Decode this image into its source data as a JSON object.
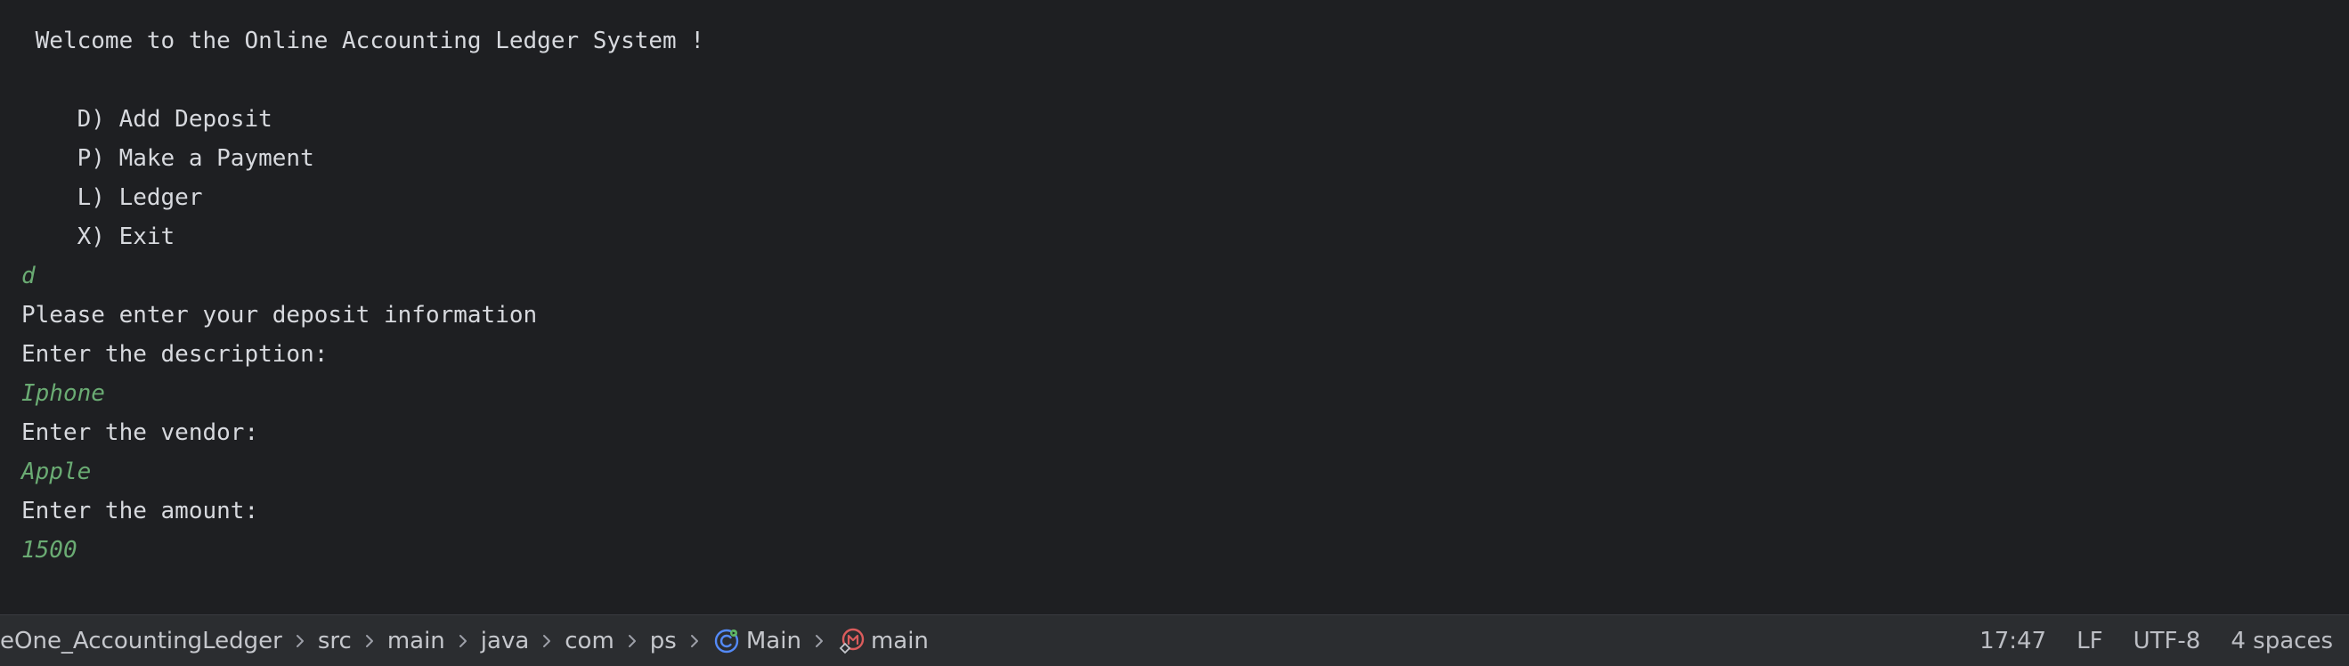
{
  "console": {
    "lines": [
      {
        "text": " Welcome to the Online Accounting Ledger System !",
        "kind": "output"
      },
      {
        "text": "    D) Add Deposit",
        "kind": "output"
      },
      {
        "text": "    P) Make a Payment",
        "kind": "output"
      },
      {
        "text": "    L) Ledger",
        "kind": "output"
      },
      {
        "text": "    X) Exit",
        "kind": "output"
      },
      {
        "text": "d",
        "kind": "input"
      },
      {
        "text": "Please enter your deposit information",
        "kind": "output"
      },
      {
        "text": "Enter the description:",
        "kind": "output"
      },
      {
        "text": "Iphone",
        "kind": "input"
      },
      {
        "text": "Enter the vendor:",
        "kind": "output"
      },
      {
        "text": "Apple",
        "kind": "input"
      },
      {
        "text": "Enter the amount:",
        "kind": "output"
      },
      {
        "text": "1500",
        "kind": "input"
      }
    ],
    "colors": {
      "background": "#1e1f22",
      "output_text": "#d7d9de",
      "user_input_text": "#6aab73"
    }
  },
  "status_bar": {
    "breadcrumbs": [
      {
        "label": "eOne_AccountingLedger",
        "icon": null
      },
      {
        "label": "src",
        "icon": null
      },
      {
        "label": "main",
        "icon": null
      },
      {
        "label": "java",
        "icon": null
      },
      {
        "label": "com",
        "icon": null
      },
      {
        "label": "ps",
        "icon": null
      },
      {
        "label": "Main",
        "icon": "class-icon"
      },
      {
        "label": "main",
        "icon": "method-icon"
      }
    ],
    "separator_icon": "chevron-right-icon",
    "cursor_position": "17:47",
    "line_separator": "LF",
    "encoding": "UTF-8",
    "indent": "4 spaces",
    "colors": {
      "background": "#2b2d30",
      "text": "#bcbec4",
      "class_icon": "#548af7",
      "method_icon": "#db5c5c"
    }
  }
}
